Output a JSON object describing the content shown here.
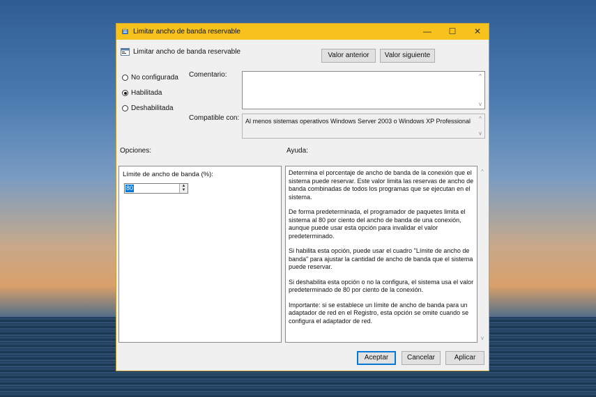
{
  "window": {
    "title": "Limitar ancho de banda reservable",
    "minimize_glyph": "—",
    "maximize_glyph": "☐",
    "close_glyph": "✕"
  },
  "header": {
    "policy_name": "Limitar ancho de banda reservable",
    "prev_button": "Valor anterior",
    "next_button": "Valor siguiente"
  },
  "state": {
    "options": [
      {
        "label": "No configurada",
        "selected": false
      },
      {
        "label": "Habilitada",
        "selected": true
      },
      {
        "label": "Deshabilitada",
        "selected": false
      }
    ]
  },
  "comment": {
    "label": "Comentario:",
    "value": ""
  },
  "compatible": {
    "label": "Compatible con:",
    "value": "Al menos sistemas operativos Windows Server 2003 o Windows XP Professional"
  },
  "options_panel": {
    "heading": "Opciones:",
    "field_label": "Límite de ancho de banda (%):",
    "field_value": "80"
  },
  "help_panel": {
    "heading": "Ayuda:",
    "paragraphs": [
      "Determina el porcentaje de ancho de banda de la conexión que el sistema puede reservar. Este valor limita las reservas de ancho de banda combinadas de todos los programas que se ejecutan en el sistema.",
      "De forma predeterminada, el programador de paquetes limita el sistema al 80 por ciento del ancho de banda de una conexión, aunque puede usar esta opción para invalidar el valor predeterminado.",
      "Si habilita esta opción, puede usar el cuadro \"Límite de ancho de banda\" para ajustar la cantidad de ancho de banda que el sistema puede reservar.",
      "Si deshabilita esta opción o no la configura, el sistema usa el valor predeterminado de 80 por ciento de la conexión.",
      "Importante: si se establece un límite de ancho de banda para un adaptador de red en el Registro, esta opción se omite cuando se configura el adaptador de red."
    ]
  },
  "footer": {
    "ok": "Aceptar",
    "cancel": "Cancelar",
    "apply": "Aplicar"
  }
}
